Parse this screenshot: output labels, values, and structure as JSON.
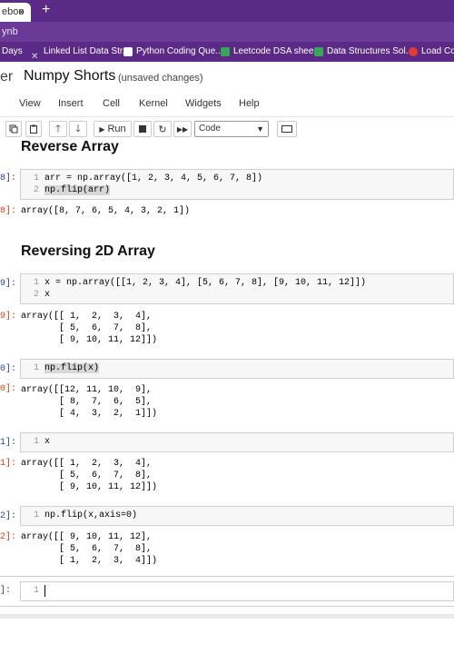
{
  "browser": {
    "tab_label": "eboo",
    "tab_close": "×",
    "new_tab": "+",
    "address": "ynb",
    "bookmarks": [
      {
        "label": "Days",
        "color": "#5b2a86"
      },
      {
        "label": "Linked List Data Str...",
        "color": "#e5e5e5"
      },
      {
        "label": "Python Coding Que...",
        "color": "#ffffff"
      },
      {
        "label": "Leetcode DSA shee...",
        "color": "#34a853"
      },
      {
        "label": "Data Structures Sol...",
        "color": "#34a853"
      },
      {
        "label": "Load Co",
        "color": "#e53935"
      }
    ]
  },
  "jupyter": {
    "logo": "er",
    "notebook_title": "Numpy Shorts",
    "save_status": "(unsaved changes)",
    "menu": [
      "View",
      "Insert",
      "Cell",
      "Kernel",
      "Widgets",
      "Help"
    ],
    "toolbar": {
      "run_label": "Run",
      "cell_type": "Code"
    }
  },
  "cells": {
    "heading1": "Reverse Array",
    "c1": {
      "prompt": "8]:",
      "lines": [
        "arr = np.array([1, 2, 3, 4, 5, 6, 7, 8])",
        "np.flip(arr)"
      ],
      "out_prompt": "8]:",
      "output": "array([8, 7, 6, 5, 4, 3, 2, 1])"
    },
    "heading2": "Reversing 2D Array",
    "c2": {
      "prompt": "9]:",
      "lines": [
        "x = np.array([[1, 2, 3, 4], [5, 6, 7, 8], [9, 10, 11, 12]])",
        "x"
      ],
      "out_prompt": "9]:",
      "output": "array([[ 1,  2,  3,  4],\n       [ 5,  6,  7,  8],\n       [ 9, 10, 11, 12]])"
    },
    "c3": {
      "prompt": "0]:",
      "lines": [
        "np.flip(x)"
      ],
      "out_prompt": "0]:",
      "output": "array([[12, 11, 10,  9],\n       [ 8,  7,  6,  5],\n       [ 4,  3,  2,  1]])"
    },
    "c4": {
      "prompt": "1]:",
      "lines": [
        "x"
      ],
      "out_prompt": "1]:",
      "output": "array([[ 1,  2,  3,  4],\n       [ 5,  6,  7,  8],\n       [ 9, 10, 11, 12]])"
    },
    "c5": {
      "prompt": "2]:",
      "lines": [
        "np.flip(x,axis=0)"
      ],
      "out_prompt": "2]:",
      "output": "array([[ 9, 10, 11, 12],\n       [ 5,  6,  7,  8],\n       [ 1,  2,  3,  4]])"
    },
    "c6": {
      "prompt": "]:",
      "line_number": "1"
    }
  },
  "line_numbers": [
    "1",
    "2"
  ]
}
